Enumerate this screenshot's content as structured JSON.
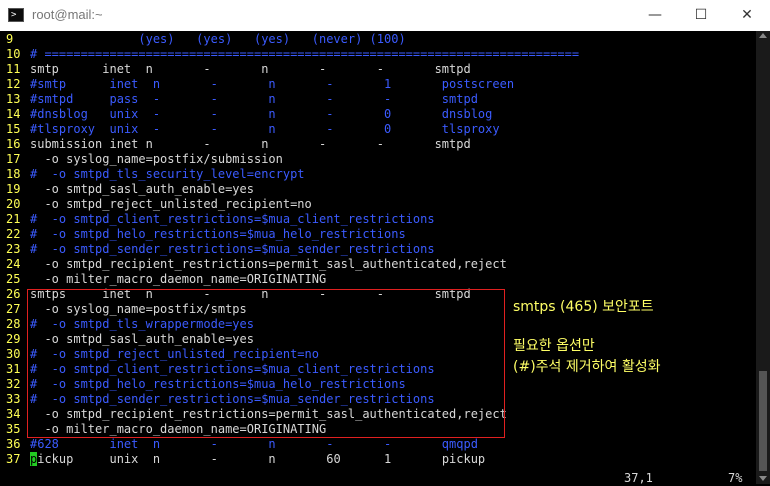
{
  "window": {
    "title": "root@mail:~",
    "minimize_glyph": "—",
    "maximize_glyph": "☐",
    "close_glyph": "✕"
  },
  "lines": [
    {
      "n": "9",
      "t": "               (yes)   (yes)   (yes)   (never) (100)",
      "c": "b"
    },
    {
      "n": "10",
      "t": "# ==========================================================================",
      "c": "b"
    },
    {
      "n": "11",
      "t": "smtp      inet  n       -       n       -       -       smtpd",
      "c": "w"
    },
    {
      "n": "12",
      "t": "#smtp      inet  n       -       n       -       1       postscreen",
      "c": "b"
    },
    {
      "n": "13",
      "t": "#smtpd     pass  -       -       n       -       -       smtpd",
      "c": "b"
    },
    {
      "n": "14",
      "t": "#dnsblog   unix  -       -       n       -       0       dnsblog",
      "c": "b"
    },
    {
      "n": "15",
      "t": "#tlsproxy  unix  -       -       n       -       0       tlsproxy",
      "c": "b"
    },
    {
      "n": "16",
      "t": "submission inet n       -       n       -       -       smtpd",
      "c": "w"
    },
    {
      "n": "17",
      "t": "  -o syslog_name=postfix/submission",
      "c": "w"
    },
    {
      "n": "18",
      "t": "#  -o smtpd_tls_security_level=encrypt",
      "c": "b"
    },
    {
      "n": "19",
      "t": "  -o smtpd_sasl_auth_enable=yes",
      "c": "w"
    },
    {
      "n": "20",
      "t": "  -o smtpd_reject_unlisted_recipient=no",
      "c": "w"
    },
    {
      "n": "21",
      "t": "#  -o smtpd_client_restrictions=$mua_client_restrictions",
      "c": "b"
    },
    {
      "n": "22",
      "t": "#  -o smtpd_helo_restrictions=$mua_helo_restrictions",
      "c": "b"
    },
    {
      "n": "23",
      "t": "#  -o smtpd_sender_restrictions=$mua_sender_restrictions",
      "c": "b"
    },
    {
      "n": "24",
      "t": "  -o smtpd_recipient_restrictions=permit_sasl_authenticated,reject",
      "c": "w"
    },
    {
      "n": "25",
      "t": "  -o milter_macro_daemon_name=ORIGINATING",
      "c": "w"
    },
    {
      "n": "26",
      "t": "smtps     inet  n       -       n       -       -       smtpd",
      "c": "w"
    },
    {
      "n": "27",
      "t": "  -o syslog_name=postfix/smtps",
      "c": "w"
    },
    {
      "n": "28",
      "t": "#  -o smtpd_tls_wrappermode=yes",
      "c": "b"
    },
    {
      "n": "29",
      "t": "  -o smtpd_sasl_auth_enable=yes",
      "c": "w"
    },
    {
      "n": "30",
      "t": "#  -o smtpd_reject_unlisted_recipient=no",
      "c": "b"
    },
    {
      "n": "31",
      "t": "#  -o smtpd_client_restrictions=$mua_client_restrictions",
      "c": "b"
    },
    {
      "n": "32",
      "t": "#  -o smtpd_helo_restrictions=$mua_helo_restrictions",
      "c": "b"
    },
    {
      "n": "33",
      "t": "#  -o smtpd_sender_restrictions=$mua_sender_restrictions",
      "c": "b"
    },
    {
      "n": "34",
      "t": "  -o smtpd_recipient_restrictions=permit_sasl_authenticated,reject",
      "c": "w"
    },
    {
      "n": "35",
      "t": "  -o milter_macro_daemon_name=ORIGINATING",
      "c": "w"
    },
    {
      "n": "36",
      "t": "#628       inet  n       -       n       -       -       qmqpd",
      "c": "b"
    },
    {
      "n": "37",
      "t": "ickup     unix  n       -       n       60      1       pickup",
      "c": "w",
      "cursor": "p"
    }
  ],
  "status": {
    "position": "37,1",
    "percent": "7%"
  },
  "annotation": {
    "line1": "smtps (465) 보안포트",
    "line2": "필요한 옵션만",
    "line3": "(#)주석 제거하여 활성화"
  }
}
